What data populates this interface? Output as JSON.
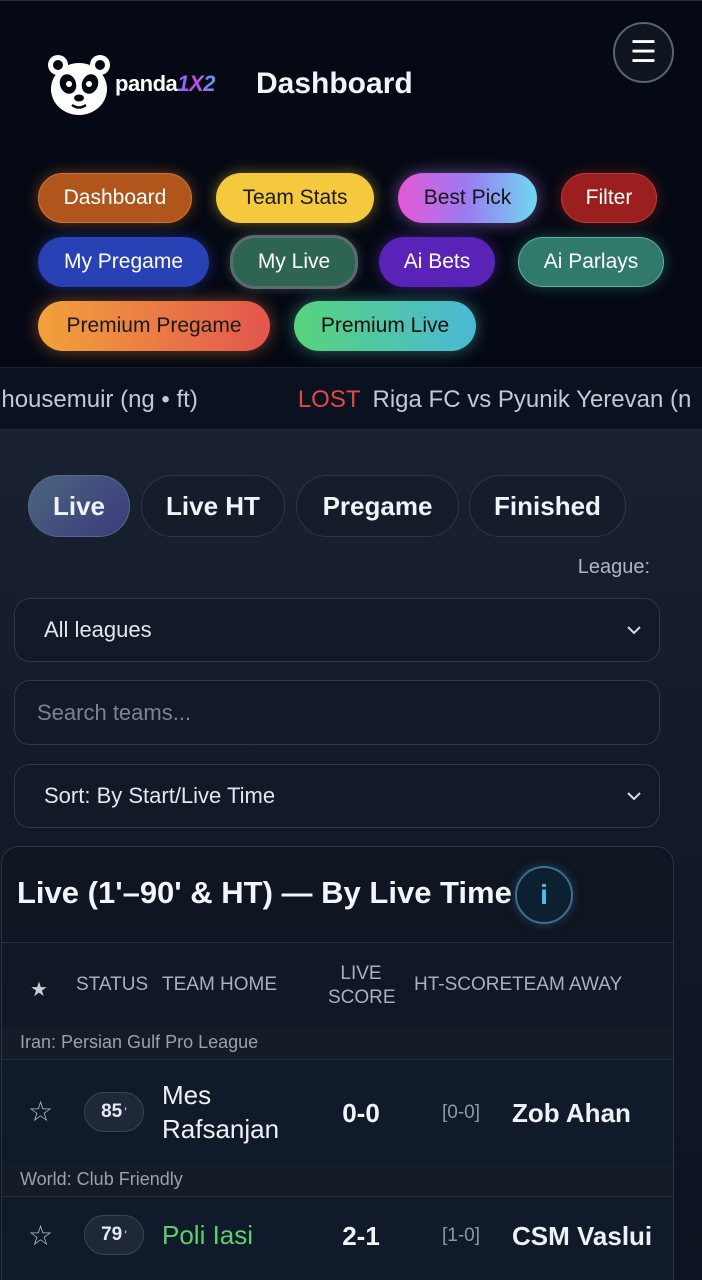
{
  "header": {
    "brand_main": "panda",
    "brand_accent": "1X2",
    "title": "Dashboard",
    "menu_icon": "hamburger-menu-icon"
  },
  "nav": {
    "dashboard": "Dashboard",
    "team_stats": "Team Stats",
    "best_pick": "Best Pick",
    "filter": "Filter",
    "my_pregame": "My Pregame",
    "my_live": "My Live",
    "ai_bets": "Ai Bets",
    "ai_parlays": "Ai Parlays",
    "premium_pregame": "Premium Pregame",
    "premium_live": "Premium Live"
  },
  "ticker": {
    "prev_text": "nhousemuir (ng • ft)",
    "status": "LOST",
    "text": "Riga FC vs Pyunik Yerevan (n"
  },
  "tabs": {
    "live": "Live",
    "live_ht": "Live HT",
    "pregame": "Pregame",
    "finished": "Finished",
    "active": "Live"
  },
  "filters": {
    "league_label": "League:",
    "league_value": "All leagues",
    "search_placeholder": "Search teams...",
    "sort_value": "Sort: By Start/Live Time"
  },
  "table": {
    "title": "Live (1'–90' & HT) — By Live Time",
    "info_label": "i",
    "headers": {
      "star": "★",
      "status": "STATUS",
      "home": "TEAM HOME",
      "score_line1": "LIVE",
      "score_line2": "SCORE",
      "ht": "HT-SCORE",
      "away": "TEAM AWAY"
    },
    "groups": [
      {
        "league": "Iran: Persian Gulf Pro League",
        "match": {
          "star": "☆",
          "minute": "85",
          "minute_mark": "'",
          "home_line1": "Mes",
          "home_line2": "Rafsanjan",
          "score": "0-0",
          "ht": "[0-0]",
          "away": "Zob Ahan"
        }
      },
      {
        "league": "World: Club Friendly",
        "match": {
          "star": "☆",
          "minute": "79",
          "minute_mark": "'",
          "home_line1": "Poli Iasi",
          "home_line2": "",
          "score": "2-1",
          "ht": "[1-0]",
          "away": "CSM Vaslui"
        }
      }
    ]
  },
  "colors": {
    "background": "#070b14",
    "win_green": "#5ed06b",
    "lost_red": "#e24848",
    "info_cyan": "#48c2ea"
  }
}
